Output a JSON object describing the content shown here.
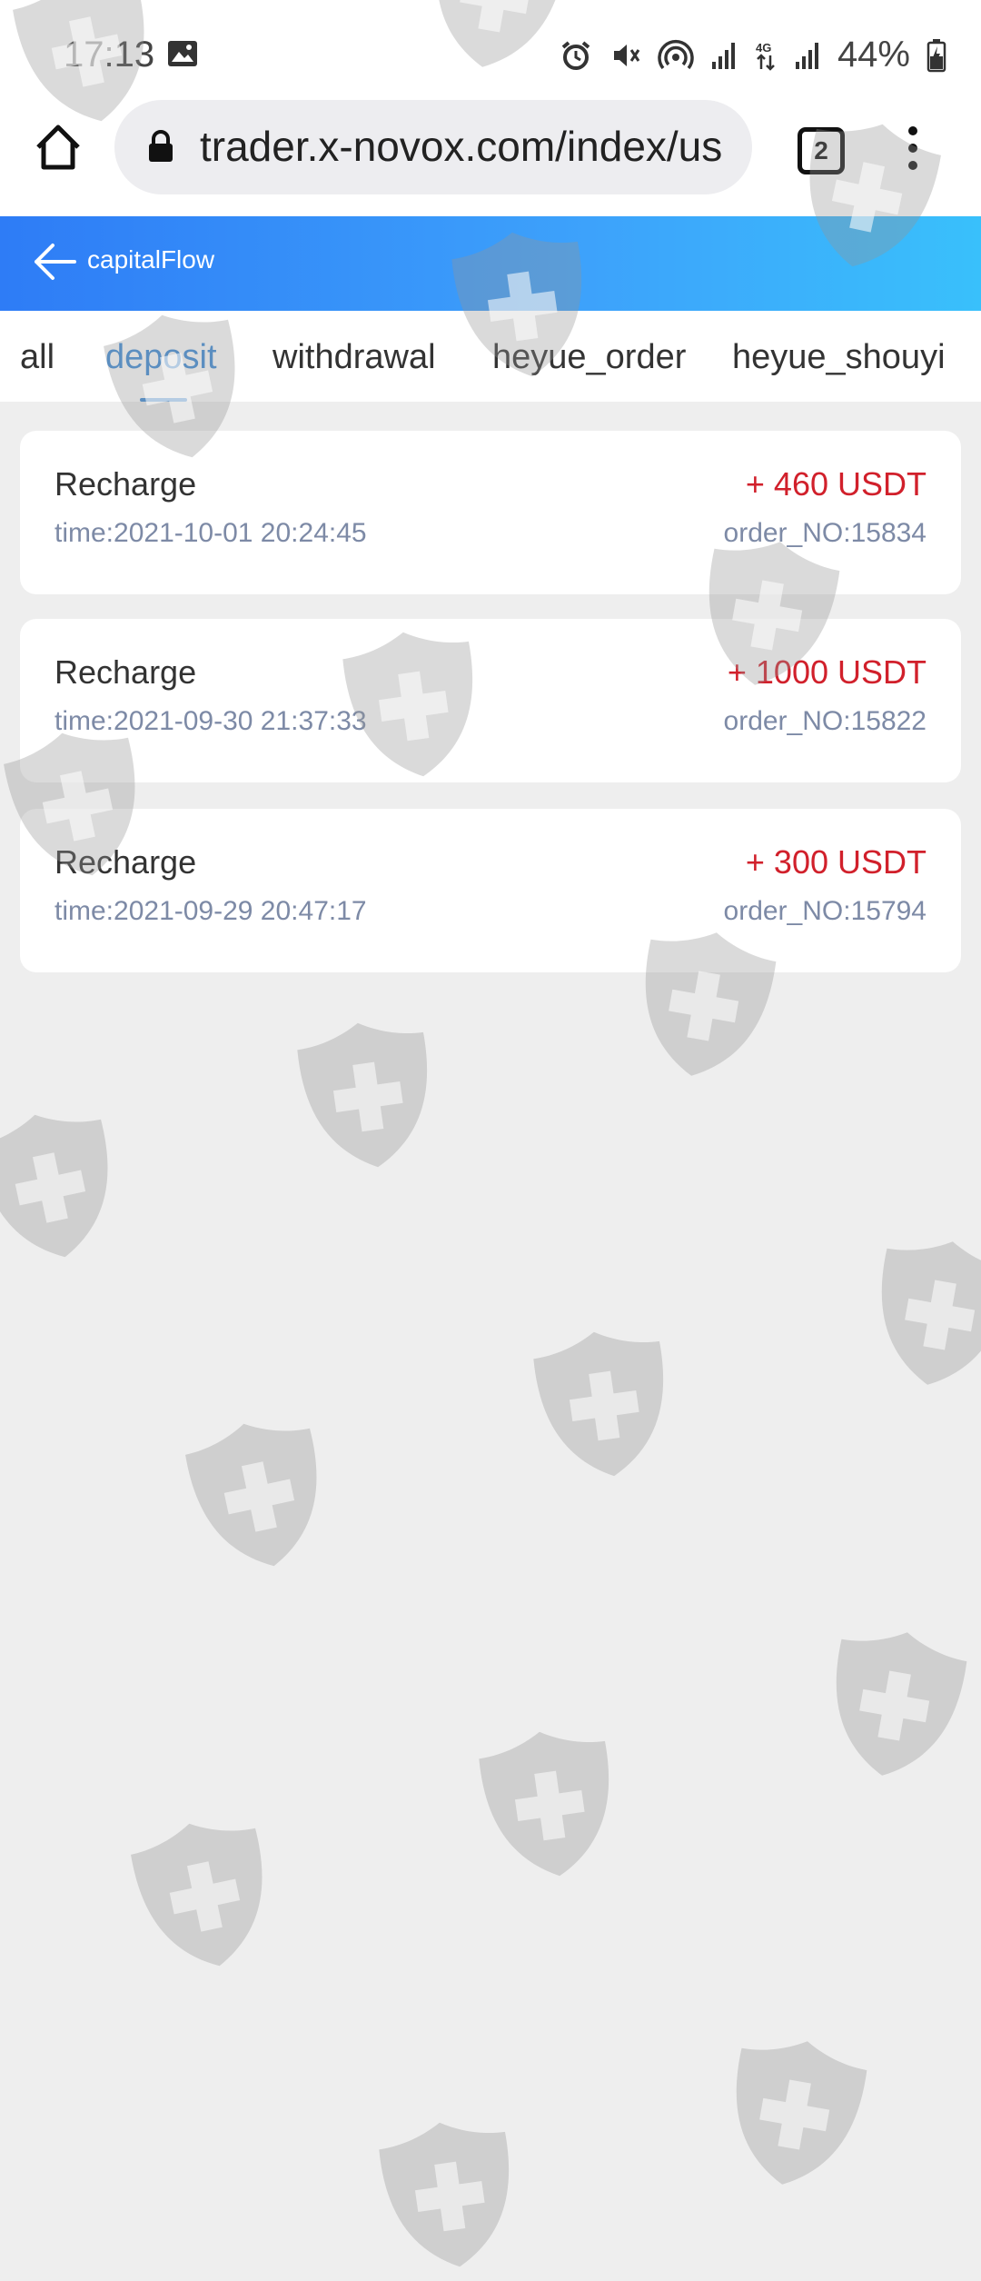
{
  "status_bar": {
    "time": "17:13",
    "battery": "44%",
    "icons": [
      "gallery-icon",
      "alarm-icon",
      "mute-icon",
      "hotspot-icon",
      "signal-icon",
      "4g-icon",
      "signal-icon",
      "battery-icon"
    ]
  },
  "browser": {
    "url": "trader.x-novox.com/index/us",
    "tab_count": "2"
  },
  "header": {
    "title": "capitalFlow"
  },
  "tabs": [
    {
      "label": "all",
      "active": false
    },
    {
      "label": "deposit",
      "active": true
    },
    {
      "label": "withdrawal",
      "active": false
    },
    {
      "label": "heyue_order",
      "active": false
    },
    {
      "label": "heyue_shouyi",
      "active": false
    }
  ],
  "records": [
    {
      "title": "Recharge",
      "time": "time:2021-10-01 20:24:45",
      "amount": "+ 460 USDT",
      "order": "order_NO:15834"
    },
    {
      "title": "Recharge",
      "time": "time:2021-09-30 21:37:33",
      "amount": "+ 1000 USDT",
      "order": "order_NO:15822"
    },
    {
      "title": "Recharge",
      "time": "time:2021-09-29 20:47:17",
      "amount": "+ 300 USDT",
      "order": "order_NO:15794"
    }
  ],
  "colors": {
    "accent": "#3d8bd8",
    "amount": "#d1202b",
    "header_start": "#2e7cf6",
    "header_end": "#39c0fb"
  }
}
